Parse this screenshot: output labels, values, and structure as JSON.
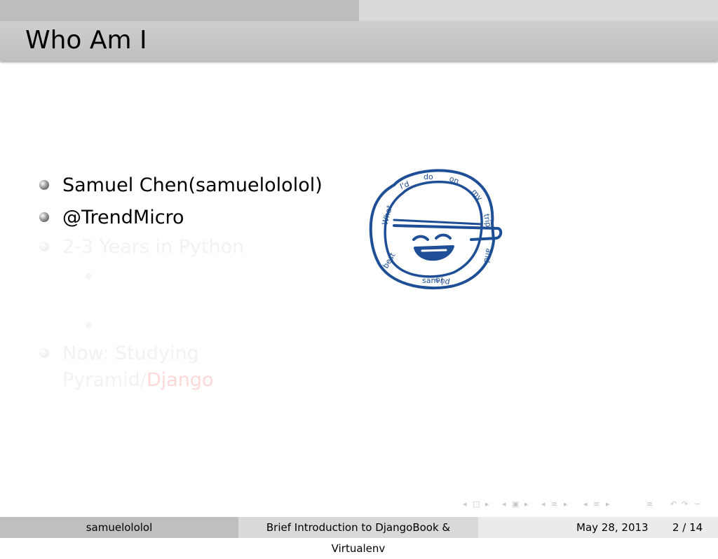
{
  "slide": {
    "title": "Who Am I",
    "items": [
      {
        "text": "Samuel Chen(samuelololol)"
      },
      {
        "text": "@TrendMicro"
      },
      {
        "text": "2-3 Years in Python"
      },
      {
        "text_line1": "Now: Studying",
        "text_line2_a": "Pyramid/",
        "text_line2_b": "Django"
      }
    ],
    "avatar_text": "What I'd do on my trip and i sam | pue of the best ~"
  },
  "footer": {
    "author": "samuelololol",
    "talk_title": "Brief Introduction to DjangoBook & Virtualenv",
    "date": "May 28, 2013",
    "page": "2 / 14"
  },
  "colors": {
    "avatar_blue": "#1e4f96",
    "header_bg": "#c4c4c4",
    "accent_red": "#e03030"
  }
}
